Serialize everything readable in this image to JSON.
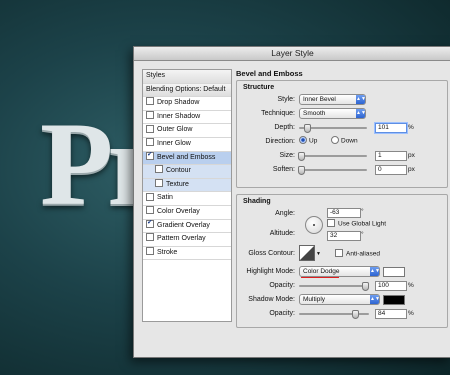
{
  "background_text": "Pr",
  "dialog": {
    "title": "Layer Style"
  },
  "sidebar": {
    "header": "Styles",
    "blending": "Blending Options: Default",
    "items": [
      {
        "label": "Drop Shadow",
        "checked": false
      },
      {
        "label": "Inner Shadow",
        "checked": false
      },
      {
        "label": "Outer Glow",
        "checked": false
      },
      {
        "label": "Inner Glow",
        "checked": false
      },
      {
        "label": "Bevel and Emboss",
        "checked": true
      },
      {
        "label": "Contour",
        "checked": false
      },
      {
        "label": "Texture",
        "checked": false
      },
      {
        "label": "Satin",
        "checked": false
      },
      {
        "label": "Color Overlay",
        "checked": false
      },
      {
        "label": "Gradient Overlay",
        "checked": true
      },
      {
        "label": "Pattern Overlay",
        "checked": false
      },
      {
        "label": "Stroke",
        "checked": false
      }
    ]
  },
  "bevel": {
    "title": "Bevel and Emboss",
    "structure": {
      "title": "Structure",
      "style_label": "Style:",
      "style_value": "Inner Bevel",
      "technique_label": "Technique:",
      "technique_value": "Smooth",
      "depth_label": "Depth:",
      "depth_value": "101",
      "depth_unit": "%",
      "direction_label": "Direction:",
      "dir_up": "Up",
      "dir_down": "Down",
      "size_label": "Size:",
      "size_value": "1",
      "size_unit": "px",
      "soften_label": "Soften:",
      "soften_value": "0",
      "soften_unit": "px"
    },
    "shading": {
      "title": "Shading",
      "angle_label": "Angle:",
      "angle_value": "-63",
      "angle_unit": "°",
      "global_light_label": "Use Global Light",
      "altitude_label": "Altitude:",
      "altitude_value": "32",
      "altitude_unit": "°",
      "gloss_label": "Gloss Contour:",
      "anti_aliased_label": "Anti-aliased",
      "highlight_label": "Highlight Mode:",
      "highlight_value": "Color Dodge",
      "highlight_color": "#ffffff",
      "opacity1_label": "Opacity:",
      "opacity1_value": "100",
      "opacity1_unit": "%",
      "shadow_label": "Shadow Mode:",
      "shadow_value": "Multiply",
      "shadow_color": "#000000",
      "opacity2_label": "Opacity:",
      "opacity2_value": "84",
      "opacity2_unit": "%"
    }
  },
  "sliders": {
    "depth": 0.1,
    "size": 0.0,
    "soften": 0.0,
    "opacity1": 1.0,
    "opacity2": 0.84
  }
}
